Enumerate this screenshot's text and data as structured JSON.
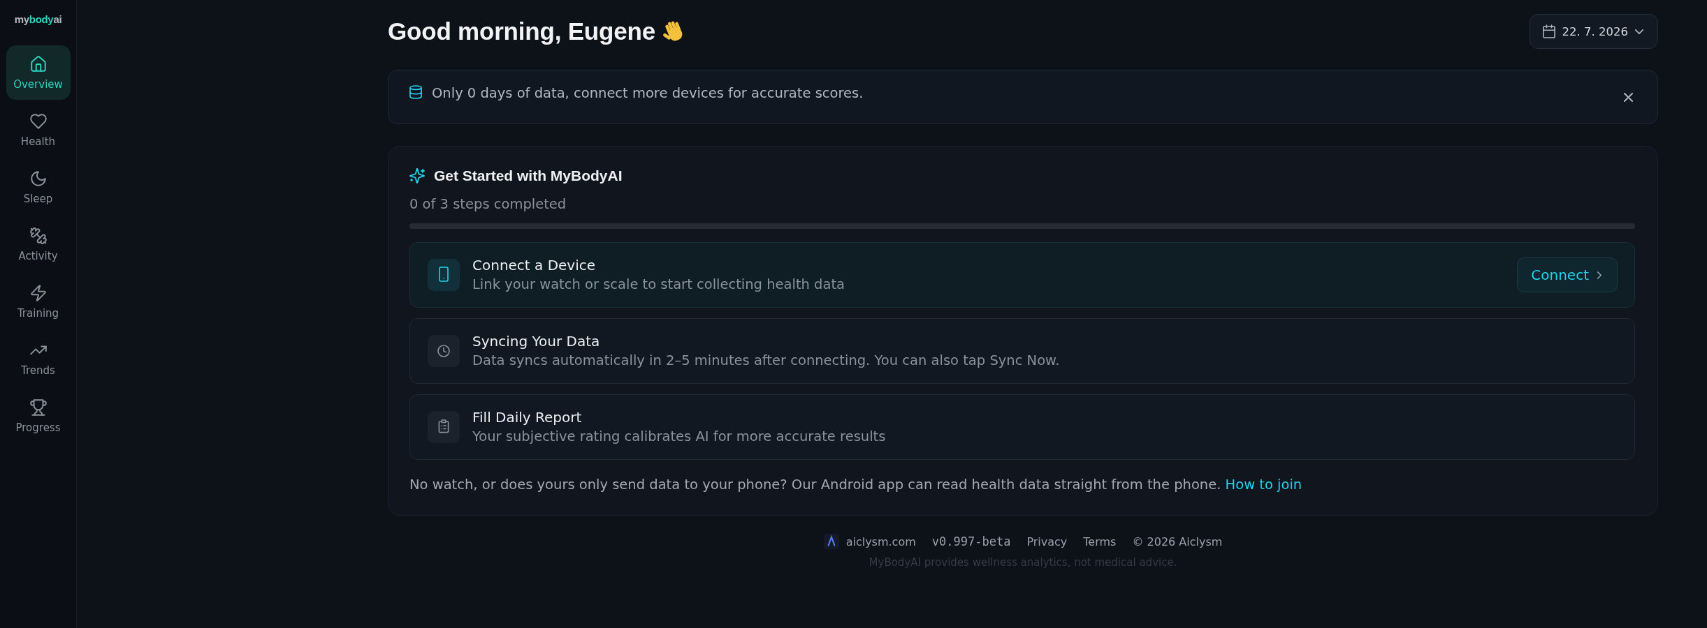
{
  "sidebar": {
    "logo": [
      {
        "text": "my",
        "accent": false
      },
      {
        "text": "body",
        "accent": true
      },
      {
        "text": "ai",
        "accent": false
      }
    ],
    "items": [
      {
        "label": "Overview",
        "selected": true
      },
      {
        "label": "Health",
        "selected": false
      },
      {
        "label": "Sleep",
        "selected": false
      },
      {
        "label": "Activity",
        "selected": false
      },
      {
        "label": "Training",
        "selected": false
      },
      {
        "label": "Trends",
        "selected": false
      },
      {
        "label": "Progress",
        "selected": false
      }
    ]
  },
  "header": {
    "greeting": "Good morning, Eugene",
    "date": "22. 7. 2026"
  },
  "notice": {
    "text": "Only 0 days of data, connect more devices for accurate scores."
  },
  "onboarding": {
    "title": "Get Started with MyBodyAI",
    "progress_text": "0 of 3 steps completed",
    "level": 0,
    "steps": [
      {
        "title": "Connect a Device",
        "description": "Link your watch or scale to start collecting health data",
        "active": true,
        "action": "Connect"
      },
      {
        "title": "Syncing Your Data",
        "description": "Data syncs automatically in 2–5 minutes after connecting. You can also tap Sync Now.",
        "active": false
      },
      {
        "title": "Fill Daily Report",
        "description": "Your subjective rating calibrates AI for more accurate results",
        "active": false
      }
    ],
    "note": {
      "text": "No watch, or does yours only send data to your phone? Our Android app can read health data straight from the phone.",
      "link": "How to join"
    }
  },
  "footer": {
    "items": [
      {
        "kind": "brand",
        "label": "aiclysm.com"
      },
      {
        "kind": "version",
        "label": "v0.997-beta"
      },
      {
        "kind": "link",
        "label": "Privacy"
      },
      {
        "kind": "link",
        "label": "Terms"
      },
      {
        "kind": "text",
        "label": "© 2026 Aiclysm"
      }
    ],
    "disclaimer": "MyBodyAI provides wellness analytics, not medical advice."
  }
}
